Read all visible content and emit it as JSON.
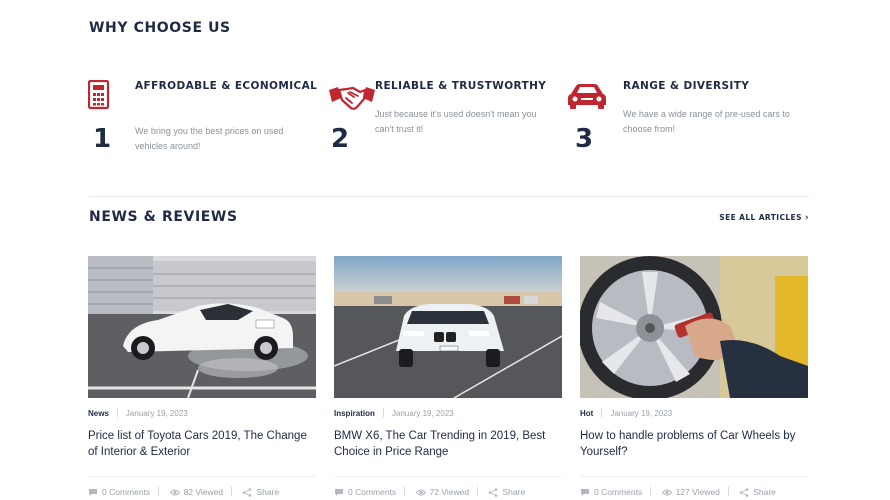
{
  "why": {
    "title": "WHY CHOOSE US",
    "accent_color": "#c0262f",
    "features": [
      {
        "icon": "calculator-icon",
        "title": "AFFRODABLE & ECONOMICAL",
        "number": "1",
        "description": "We bring you the best prices on used vehicles around!"
      },
      {
        "icon": "handshake-icon",
        "title": "RELIABLE & TRUSTWORTHY",
        "number": "2",
        "description": "Just because it's used doesn't mean you can't trust it!"
      },
      {
        "icon": "car-icon",
        "title": "RANGE & DIVERSITY",
        "number": "3",
        "description": "We have a wide range of pre-used cars to choose from!"
      }
    ]
  },
  "news": {
    "title": "NEWS & REVIEWS",
    "see_all": "SEE ALL ARTICLES",
    "articles": [
      {
        "category": "News",
        "date": "January 19, 2023",
        "title": "Price list of Toyota Cars 2019, The Change of Interior & Exterior",
        "comments": "0 Comments",
        "views": "82 Viewed",
        "share": "Share"
      },
      {
        "category": "Inspiration",
        "date": "January 19, 2023",
        "title": "BMW X6, The Car Trending in 2019, Best Choice in Price Range",
        "comments": "0 Comments",
        "views": "72 Viewed",
        "share": "Share"
      },
      {
        "category": "Hot",
        "date": "January 19, 2023",
        "title": "How to handle problems of Car Wheels by Yourself?",
        "comments": "0 Comments",
        "views": "127 Viewed",
        "share": "Share"
      }
    ]
  }
}
